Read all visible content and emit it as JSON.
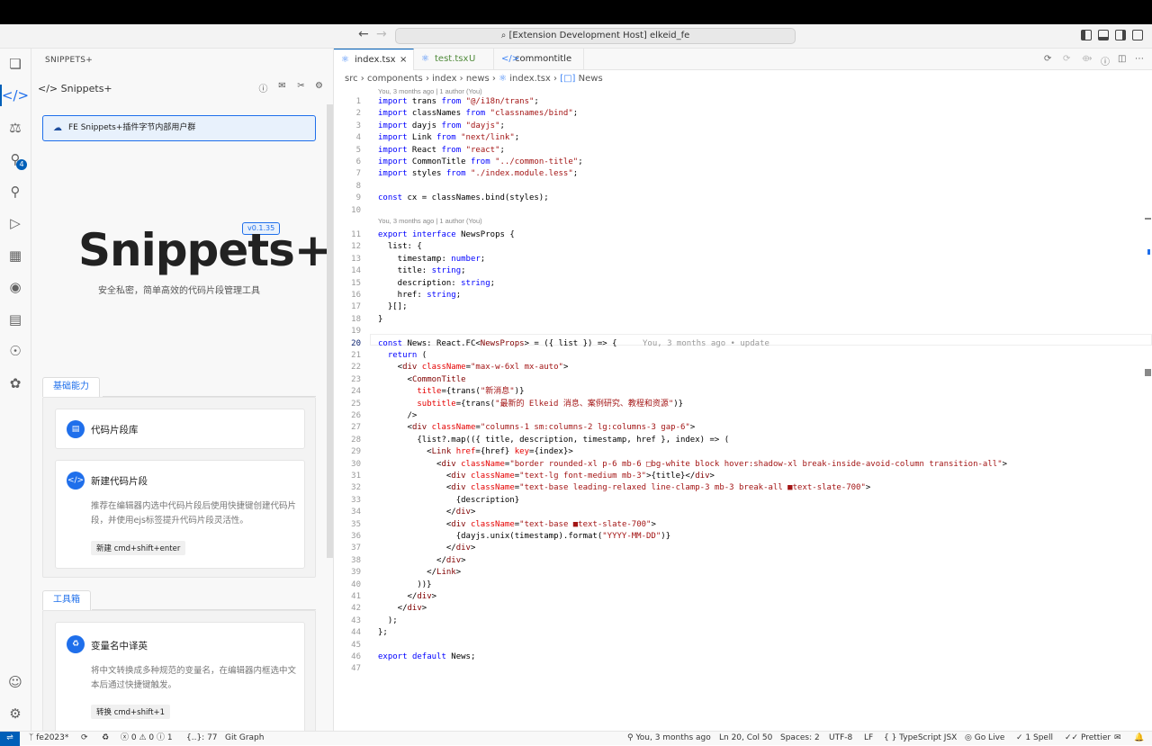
{
  "titlebar": {
    "command_center": "⌕ [Extension Development Host] elkeid_fe"
  },
  "activity": {
    "scm_badge": "4"
  },
  "sidebar": {
    "header": "SNIPPETS+",
    "view_title": "Snippets+",
    "banner": "FE Snippets+插件字节内部用户群",
    "version": "v0.1.35",
    "logo": "Snippets+",
    "slogan": "安全私密，简单高效的代码片段管理工具",
    "section1": {
      "tab": "基础能力",
      "card1": {
        "title": "代码片段库"
      },
      "card2": {
        "title": "新建代码片段",
        "desc": "推荐在编辑器内选中代码片段后使用快捷键创建代码片段，并使用ejs标签提升代码片段灵活性。",
        "button": "新建 cmd+shift+enter"
      }
    },
    "section2": {
      "tab": "工具箱",
      "card1": {
        "title": "变量名中译英",
        "desc": "将中文转换成多种规范的变量名，在编辑器内框选中文本后通过快捷键触发。",
        "button": "转换 cmd+shift+1"
      }
    }
  },
  "tabs": [
    {
      "label": "index.tsx",
      "suffix": "×"
    },
    {
      "label": "test.tsx",
      "suffix": "U"
    },
    {
      "label": "commontitle",
      "suffix": ""
    }
  ],
  "breadcrumb": {
    "src": "src",
    "components": "components",
    "index": "index",
    "news": "news",
    "file": "index.tsx",
    "symbol": "News"
  },
  "blame": {
    "line1": "You, 3 months ago | 1 author (You)",
    "line11": "You, 3 months ago | 1 author (You)",
    "inline20": "You, 3 months ago • update"
  },
  "code": [
    {
      "n": "1",
      "t": "import trans from \"@/i18n/trans\";"
    },
    {
      "n": "2",
      "t": "import classNames from \"classnames/bind\";"
    },
    {
      "n": "3",
      "t": "import dayjs from \"dayjs\";"
    },
    {
      "n": "4",
      "t": "import Link from \"next/link\";"
    },
    {
      "n": "5",
      "t": "import React from \"react\";"
    },
    {
      "n": "6",
      "t": "import CommonTitle from \"../common-title\";"
    },
    {
      "n": "7",
      "t": "import styles from \"./index.module.less\";"
    },
    {
      "n": "8",
      "t": ""
    },
    {
      "n": "9",
      "t": "const cx = classNames.bind(styles);"
    },
    {
      "n": "10",
      "t": ""
    },
    {
      "n": "11",
      "t": "export interface NewsProps {"
    },
    {
      "n": "12",
      "t": "  list: {"
    },
    {
      "n": "13",
      "t": "    timestamp: number;"
    },
    {
      "n": "14",
      "t": "    title: string;"
    },
    {
      "n": "15",
      "t": "    description: string;"
    },
    {
      "n": "16",
      "t": "    href: string;"
    },
    {
      "n": "17",
      "t": "  }[];"
    },
    {
      "n": "18",
      "t": "}"
    },
    {
      "n": "19",
      "t": ""
    },
    {
      "n": "20",
      "t": "const News: React.FC<NewsProps> = ({ list }) => {"
    },
    {
      "n": "21",
      "t": "  return ("
    },
    {
      "n": "22",
      "t": "    <div className=\"max-w-6xl mx-auto\">"
    },
    {
      "n": "23",
      "t": "      <CommonTitle"
    },
    {
      "n": "24",
      "t": "        title={trans(\"新消息\")}"
    },
    {
      "n": "25",
      "t": "        subtitle={trans(\"最新的 Elkeid 消息、案例研究、教程和资源\")}"
    },
    {
      "n": "26",
      "t": "      />"
    },
    {
      "n": "27",
      "t": "      <div className=\"columns-1 sm:columns-2 lg:columns-3 gap-6\">"
    },
    {
      "n": "28",
      "t": "        {list?.map(({ title, description, timestamp, href }, index) => ("
    },
    {
      "n": "29",
      "t": "          <Link href={href} key={index}>"
    },
    {
      "n": "30",
      "t": "            <div className=\"border rounded-xl p-6 mb-6 □bg-white block hover:shadow-xl break-inside-avoid-column transition-all\">"
    },
    {
      "n": "31",
      "t": "              <div className=\"text-lg font-medium mb-3\">{title}</div>"
    },
    {
      "n": "32",
      "t": "              <div className=\"text-base leading-relaxed line-clamp-3 mb-3 break-all ■text-slate-700\">"
    },
    {
      "n": "33",
      "t": "                {description}"
    },
    {
      "n": "34",
      "t": "              </div>"
    },
    {
      "n": "35",
      "t": "              <div className=\"text-base ■text-slate-700\">"
    },
    {
      "n": "36",
      "t": "                {dayjs.unix(timestamp).format(\"YYYY-MM-DD\")}"
    },
    {
      "n": "37",
      "t": "              </div>"
    },
    {
      "n": "38",
      "t": "            </div>"
    },
    {
      "n": "39",
      "t": "          </Link>"
    },
    {
      "n": "40",
      "t": "        ))}"
    },
    {
      "n": "41",
      "t": "      </div>"
    },
    {
      "n": "42",
      "t": "    </div>"
    },
    {
      "n": "43",
      "t": "  );"
    },
    {
      "n": "44",
      "t": "};"
    },
    {
      "n": "45",
      "t": ""
    },
    {
      "n": "46",
      "t": "export default News;"
    },
    {
      "n": "47",
      "t": ""
    }
  ],
  "status": {
    "branch": "fe2023*",
    "problems": "ⓧ 0 ⚠ 0 ⓘ 1",
    "json": "{..}: 77",
    "git_graph": "Git Graph",
    "blame": "You, 3 months ago",
    "position": "Ln 20, Col 50",
    "spaces": "Spaces: 2",
    "encoding": "UTF-8",
    "eol": "LF",
    "language": "{ } TypeScript JSX",
    "golive": "Go Live",
    "spell": "1 Spell",
    "prettier": "Prettier"
  },
  "colors": {
    "accent": "#1f6feb",
    "statusbar_remote": "#005fb8"
  }
}
